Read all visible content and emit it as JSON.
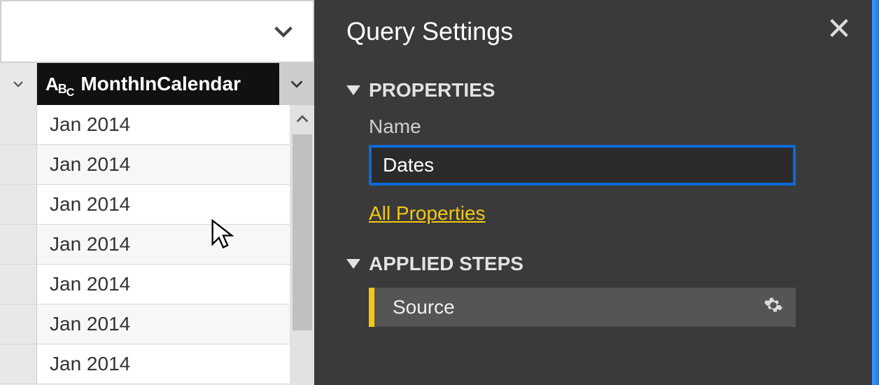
{
  "grid": {
    "column_header": "MonthInCalendar",
    "rows": [
      "Jan 2014",
      "Jan 2014",
      "Jan 2014",
      "Jan 2014",
      "Jan 2014",
      "Jan 2014",
      "Jan 2014"
    ]
  },
  "panel": {
    "title": "Query Settings",
    "sections": {
      "properties": "PROPERTIES",
      "applied_steps": "APPLIED STEPS"
    },
    "name_label": "Name",
    "name_value": "Dates",
    "all_properties": "All Properties",
    "steps": {
      "0": "Source"
    }
  }
}
